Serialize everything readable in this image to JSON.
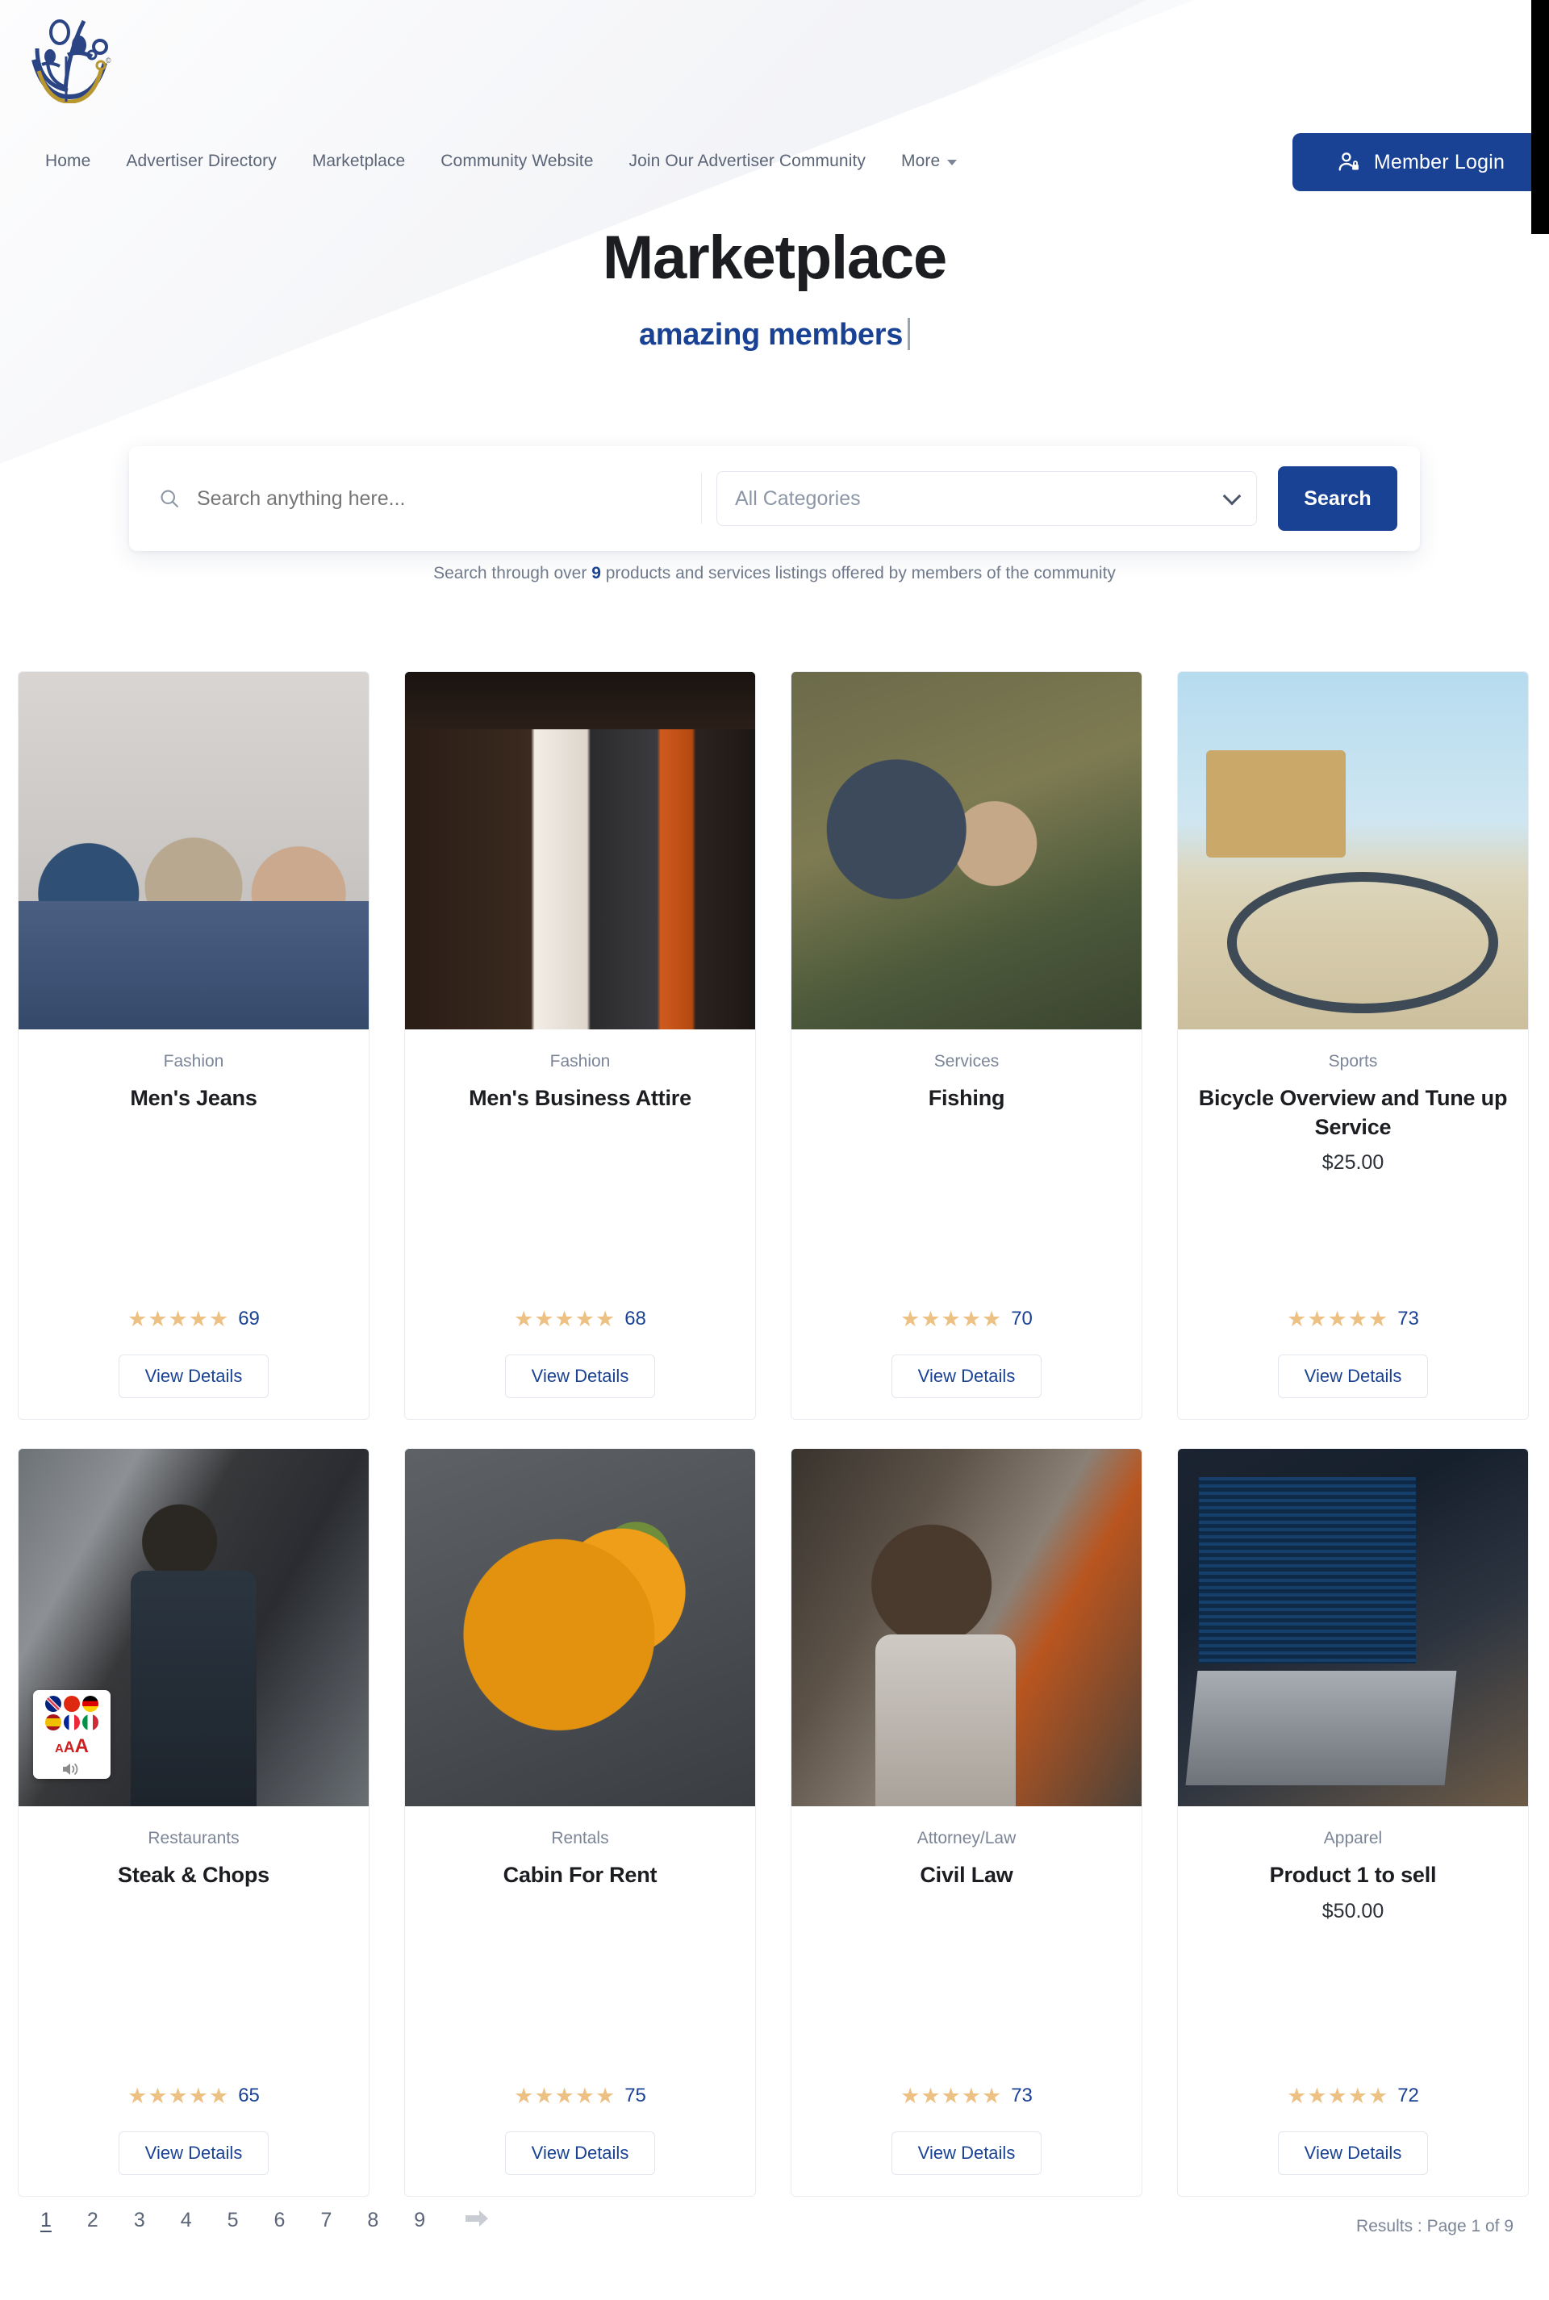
{
  "header": {
    "logo_name": "community-logo",
    "nav_items": [
      {
        "label": "Home"
      },
      {
        "label": "Advertiser Directory"
      },
      {
        "label": "Marketplace"
      },
      {
        "label": "Community Website"
      },
      {
        "label": "Join Our Advertiser Community"
      },
      {
        "label": "More"
      }
    ],
    "login_button": "Member Login",
    "login_icon": "user-lock-icon"
  },
  "hero": {
    "title": "Marketplace",
    "subtitle": "amazing members"
  },
  "search": {
    "placeholder": "Search anything here...",
    "value": "",
    "search_icon": "search-icon",
    "category_selected": "All Categories",
    "dropdown_icon": "chevron-down-icon",
    "button_label": "Search",
    "note_prefix": "Search through over ",
    "note_count": "9",
    "note_suffix": " products and services listings offered by members of the community"
  },
  "listings": [
    {
      "category": "Fashion",
      "title": "Men's Jeans",
      "price": "",
      "stars": 5,
      "rating_count": "69",
      "details_label": "View Details",
      "image_name": "mens-jeans-photo"
    },
    {
      "category": "Fashion",
      "title": "Men's Business Attire",
      "price": "",
      "stars": 5,
      "rating_count": "68",
      "details_label": "View Details",
      "image_name": "mens-business-attire-photo"
    },
    {
      "category": "Services",
      "title": "Fishing",
      "price": "",
      "stars": 5,
      "rating_count": "70",
      "details_label": "View Details",
      "image_name": "fishing-photo"
    },
    {
      "category": "Sports",
      "title": "Bicycle Overview and Tune up Service",
      "price": "$25.00",
      "stars": 5,
      "rating_count": "73",
      "details_label": "View Details",
      "image_name": "bicycle-photo"
    },
    {
      "category": "Restaurants",
      "title": "Steak & Chops",
      "price": "",
      "stars": 5,
      "rating_count": "65",
      "details_label": "View Details",
      "image_name": "steak-chops-photo"
    },
    {
      "category": "Rentals",
      "title": "Cabin For Rent",
      "price": "",
      "stars": 5,
      "rating_count": "75",
      "details_label": "View Details",
      "image_name": "cabin-for-rent-photo"
    },
    {
      "category": "Attorney/Law",
      "title": "Civil Law",
      "price": "",
      "stars": 5,
      "rating_count": "73",
      "details_label": "View Details",
      "image_name": "civil-law-photo"
    },
    {
      "category": "Apparel",
      "title": "Product 1 to sell",
      "price": "$50.00",
      "stars": 5,
      "rating_count": "72",
      "details_label": "View Details",
      "image_name": "product-1-photo"
    }
  ],
  "accessibility_widget": {
    "flags": [
      "uk-flag",
      "china-flag",
      "germany-flag",
      "spain-flag",
      "france-flag",
      "italy-flag"
    ],
    "text_size_label": "AAA",
    "speaker_icon": "speaker-icon"
  },
  "pagination": {
    "pages": [
      "1",
      "2",
      "3",
      "4",
      "5",
      "6",
      "7",
      "8",
      "9"
    ],
    "active_page": "1",
    "next_icon": "arrow-right-icon",
    "results_text": "Results : Page 1 of 9"
  },
  "colors": {
    "brand_blue": "#1a4294",
    "star_gold": "#edc183",
    "muted_text": "#7b8597",
    "hero_bg": "#eef0f4"
  }
}
